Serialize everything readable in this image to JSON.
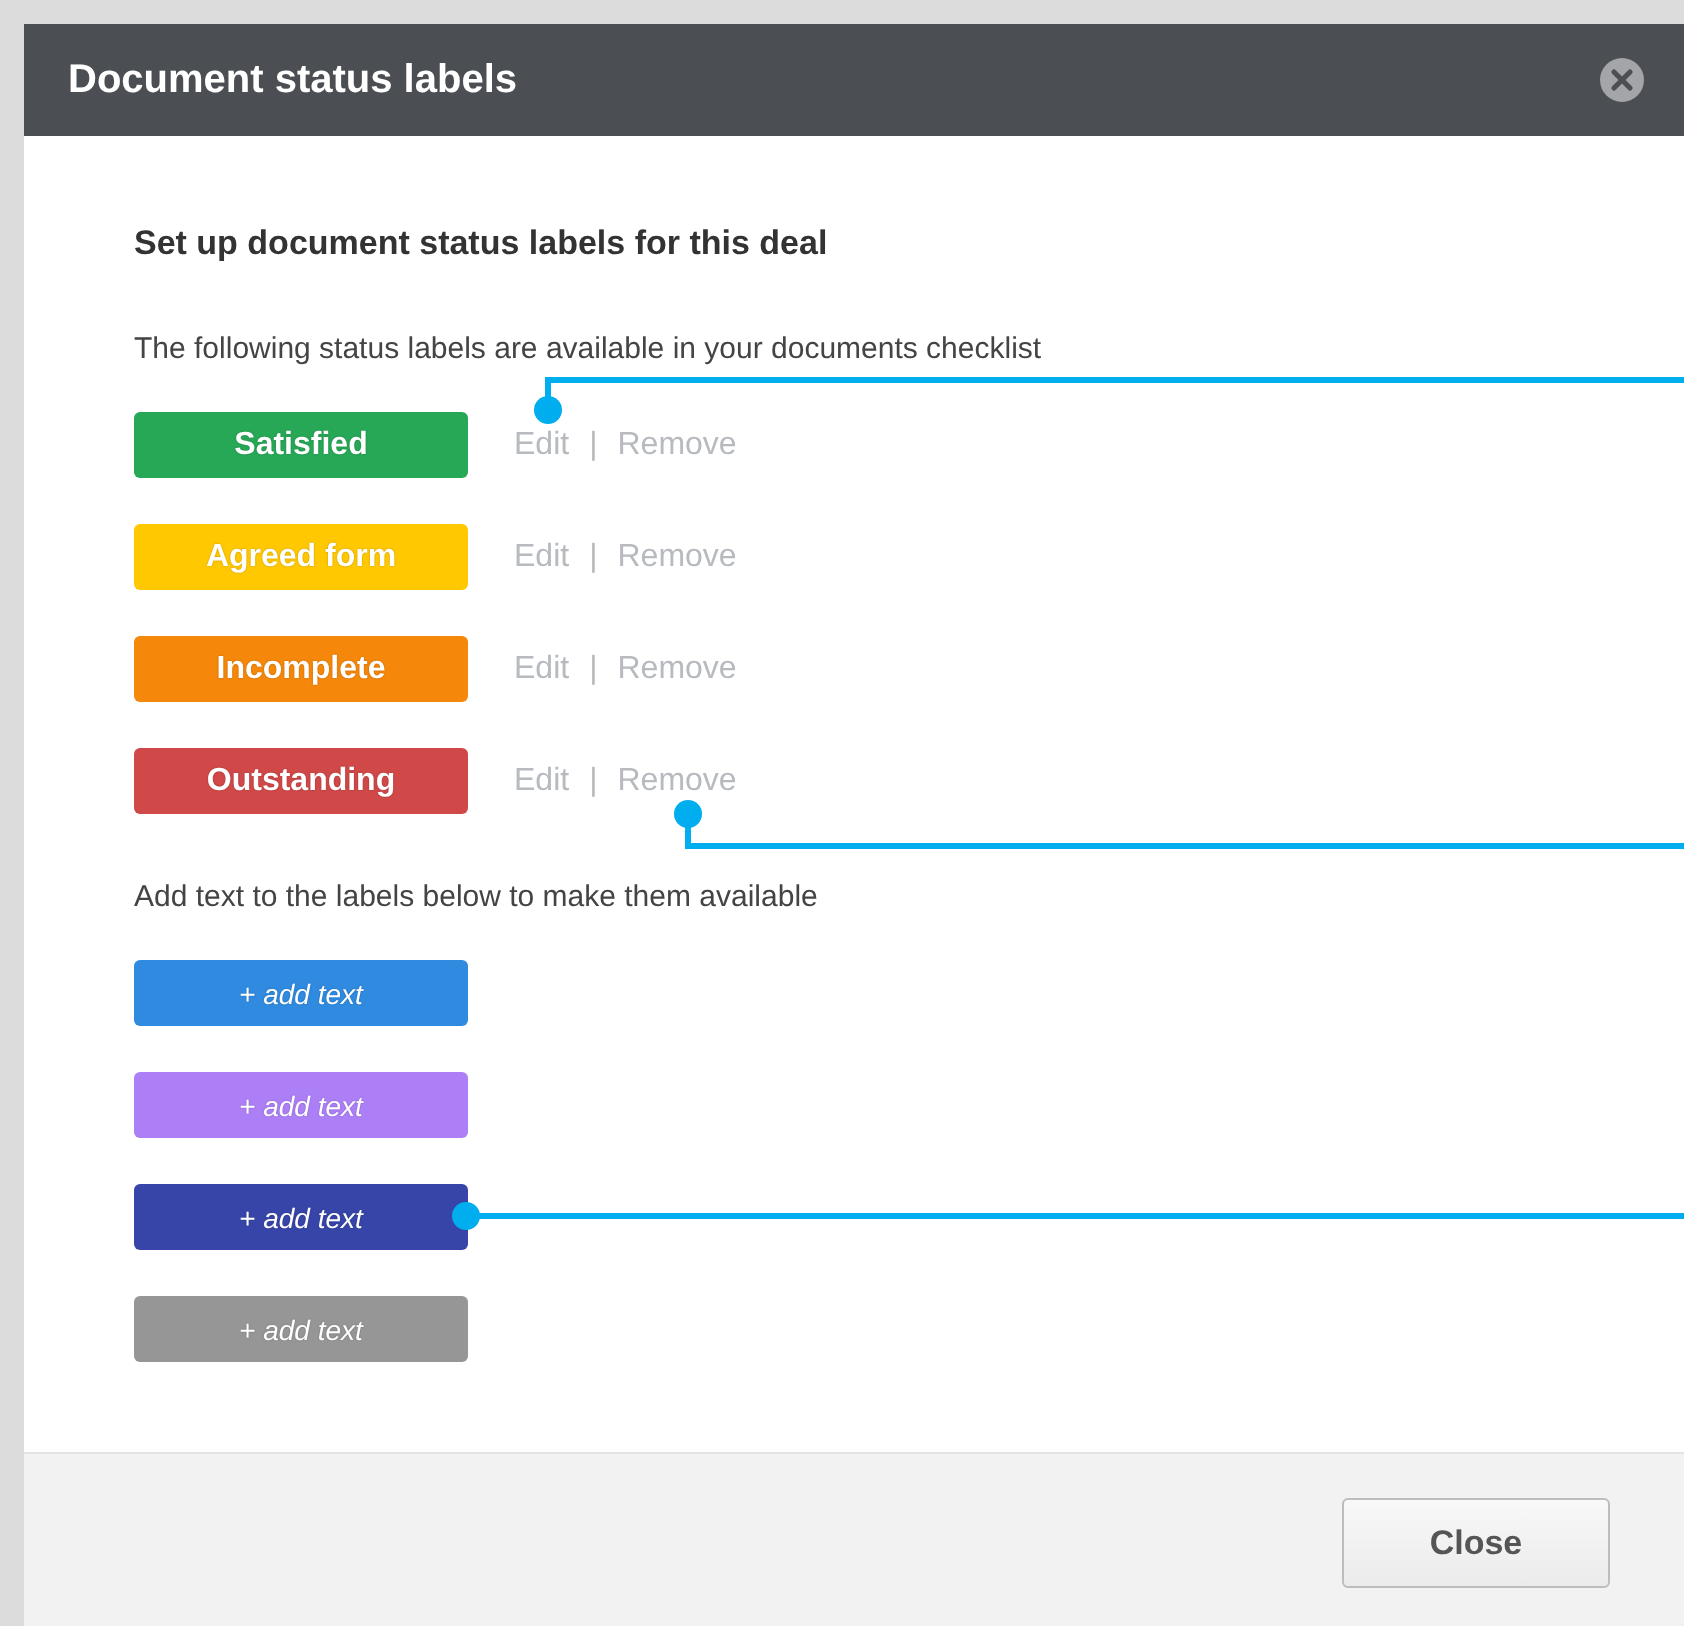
{
  "dialog": {
    "title": "Document status labels",
    "heading": "Set up document status labels for this deal",
    "available": {
      "intro": "The following status labels are available in your documents checklist",
      "labels": [
        {
          "text": "Satisfied",
          "color": "#27a857",
          "actions": [
            "Edit",
            "Remove"
          ],
          "separator": "|"
        },
        {
          "text": "Agreed form",
          "color": "#ffc800",
          "actions": [
            "Edit",
            "Remove"
          ],
          "separator": "|"
        },
        {
          "text": "Incomplete",
          "color": "#f5870a",
          "actions": [
            "Edit",
            "Remove"
          ],
          "separator": "|"
        },
        {
          "text": "Outstanding",
          "color": "#d04848",
          "actions": [
            "Edit",
            "Remove"
          ],
          "separator": "|"
        }
      ]
    },
    "unused": {
      "intro": "Add text to the labels below to make them available",
      "labels": [
        {
          "text": "+ add text",
          "color": "#2f8ae0"
        },
        {
          "text": "+ add text",
          "color": "#ad7ff7"
        },
        {
          "text": "+ add text",
          "color": "#3745a8"
        },
        {
          "text": "+ add text",
          "color": "#969696"
        }
      ]
    },
    "buttons": [
      "Close"
    ]
  }
}
